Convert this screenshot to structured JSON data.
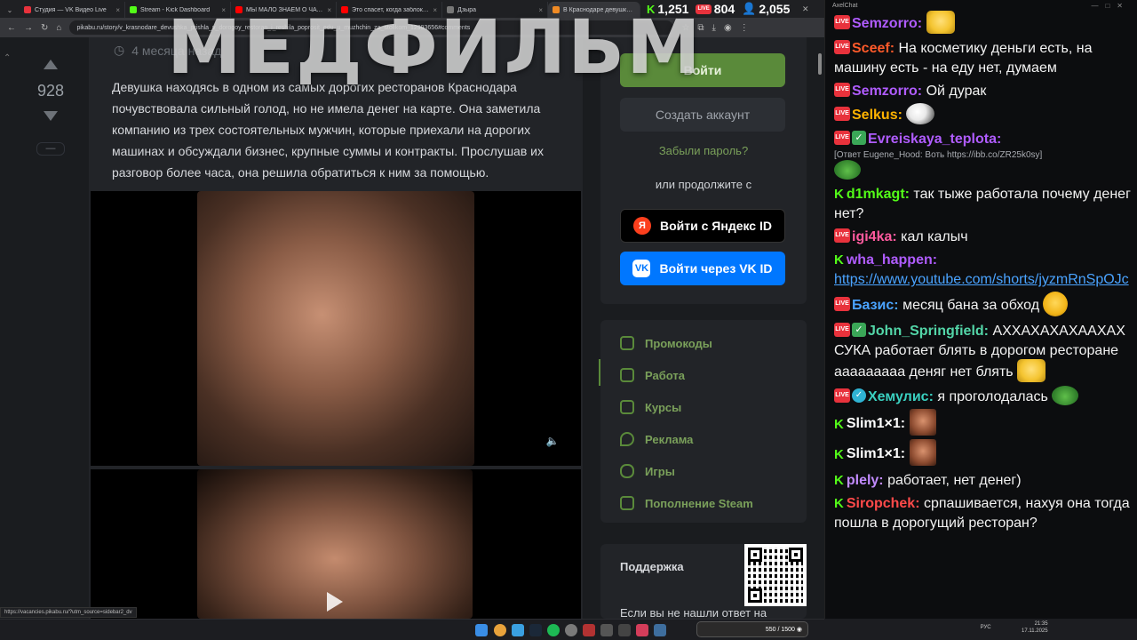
{
  "browser": {
    "tabs": [
      {
        "title": "Студия — VK Видео Live",
        "color": "#e8323c"
      },
      {
        "title": "Stream - Kick Dashboard",
        "color": "#53fc18"
      },
      {
        "title": "МЫ МАЛО ЗНАЕМ О ЧАТРУЛЕ",
        "color": "#ff0000"
      },
      {
        "title": "Это спасет, когда заблокируют",
        "color": "#ff0000"
      },
      {
        "title": "Дзыра",
        "color": "#777777"
      },
      {
        "title": "В Краснодаре девушка пр",
        "color": "#f08a24"
      }
    ],
    "url": "pikabu.ru/story/v_krasnodare_devushka_prishla_v_dorogoy_restoran_i_reshila_poprosit_edu_u_muzhchin_za_stolikom_12993656#comments",
    "status_url": "https://vacancies.pikabu.ru/?utm_source=sidebar2_dv"
  },
  "stats": {
    "kick_viewers": "1,251",
    "vk_viewers": "804",
    "followers": "2,055"
  },
  "watermark": "МЕДФИЛЬМ",
  "post": {
    "rating": "928",
    "collapse_label": "—",
    "meta_time": "4 месяца назад",
    "text": "Девушка находясь в одном из самых дорогих ресторанов Краснодара почувствовала сильный голод, но не имела денег на карте. Она заметила компанию из трех состоятельных мужчин, которые приехали на дорогих машинах и обсуждали бизнес, крупные суммы и контракты. Прослушав их разговор более часа, она решила обратиться к ним за помощью."
  },
  "auth": {
    "login": "Войти",
    "create": "Создать аккаунт",
    "forgot": "Забыли пароль?",
    "or_continue": "или продолжите с",
    "yandex": "Войти с Яндекс ID",
    "vk": "Войти через VK ID"
  },
  "menu": [
    {
      "label": "Промокоды",
      "icon": "tag-icon"
    },
    {
      "label": "Работа",
      "icon": "briefcase-icon"
    },
    {
      "label": "Курсы",
      "icon": "graduation-cap-icon"
    },
    {
      "label": "Реклама",
      "icon": "flame-icon"
    },
    {
      "label": "Игры",
      "icon": "gamepad-icon"
    },
    {
      "label": "Пополнение Steam",
      "icon": "wallet-icon"
    }
  ],
  "support": {
    "title": "Поддержка",
    "text": "Если вы не нашли ответ на"
  },
  "chat": {
    "title": "AxelChat",
    "messages": [
      {
        "platform": "vk",
        "user": "Semzorro:",
        "color": "#b05cff",
        "text": "",
        "emote": "em-face"
      },
      {
        "platform": "vk",
        "user": "Sceef:",
        "color": "#ff5a2a",
        "text": "На косметику деньги есть, на машину есть - на еду нет, думаем"
      },
      {
        "platform": "vk",
        "user": "Semzorro:",
        "color": "#b05cff",
        "text": "Ой дурак"
      },
      {
        "platform": "vk",
        "user": "Selkus:",
        "color": "#ffb300",
        "text": "",
        "emote": "em-pig"
      },
      {
        "platform": "vk",
        "badge": "check",
        "user": "Evreiskaya_teplota:",
        "color": "#b05cff",
        "text": "",
        "reply": "[Ответ Eugene_Hood: Воть https://ibb.co/ZR25k0sy]",
        "emote": "em-pepe"
      },
      {
        "platform": "kick",
        "user": "d1mkagt:",
        "color": "#53fc18",
        "text": "так тыже работала почему денег нет?"
      },
      {
        "platform": "vk",
        "user": "igi4ka:",
        "color": "#ff5a9e",
        "text": "кал калыч"
      },
      {
        "platform": "kick",
        "user": "wha_happen:",
        "color": "#b05cff",
        "link": "https://www.youtube.com/shorts/jyzmRnSpOJc"
      },
      {
        "platform": "vk",
        "user": "Базис:",
        "color": "#4aa3ff",
        "text": "месяц бана за обход",
        "emote": "em-smile"
      },
      {
        "platform": "vk",
        "badge": "check",
        "user": "John_Springfield:",
        "color": "#53d6a8",
        "text": "АХХАХАХАХААХАХ СУКА работает блять в дорогом ресторане ааааааааа деняг нет блять",
        "emote": "em-face"
      },
      {
        "platform": "vk",
        "badge": "verified",
        "user": "Хемулис:",
        "color": "#3ad0c0",
        "text": "я проголодалась",
        "emote": "em-pepe"
      },
      {
        "platform": "kick",
        "user": "Slim1×1:",
        "color": "#ffffff",
        "text": "",
        "emote": "em-photo"
      },
      {
        "platform": "kick",
        "user": "Slim1×1:",
        "color": "#ffffff",
        "text": "",
        "emote": "em-photo"
      },
      {
        "platform": "kick",
        "user": "plely:",
        "color": "#c28bff",
        "text": "работает, нет денег)"
      },
      {
        "platform": "kick",
        "user": "Siropchek:",
        "color": "#ff4a4a",
        "text": "српашивается, нахуя она тогда пошла в дорогущий ресторан?"
      }
    ]
  },
  "taskbar": {
    "widget": "550 / 1500 ◉",
    "lang": "РУС",
    "time": "21:35",
    "date": "17.11.2025"
  }
}
